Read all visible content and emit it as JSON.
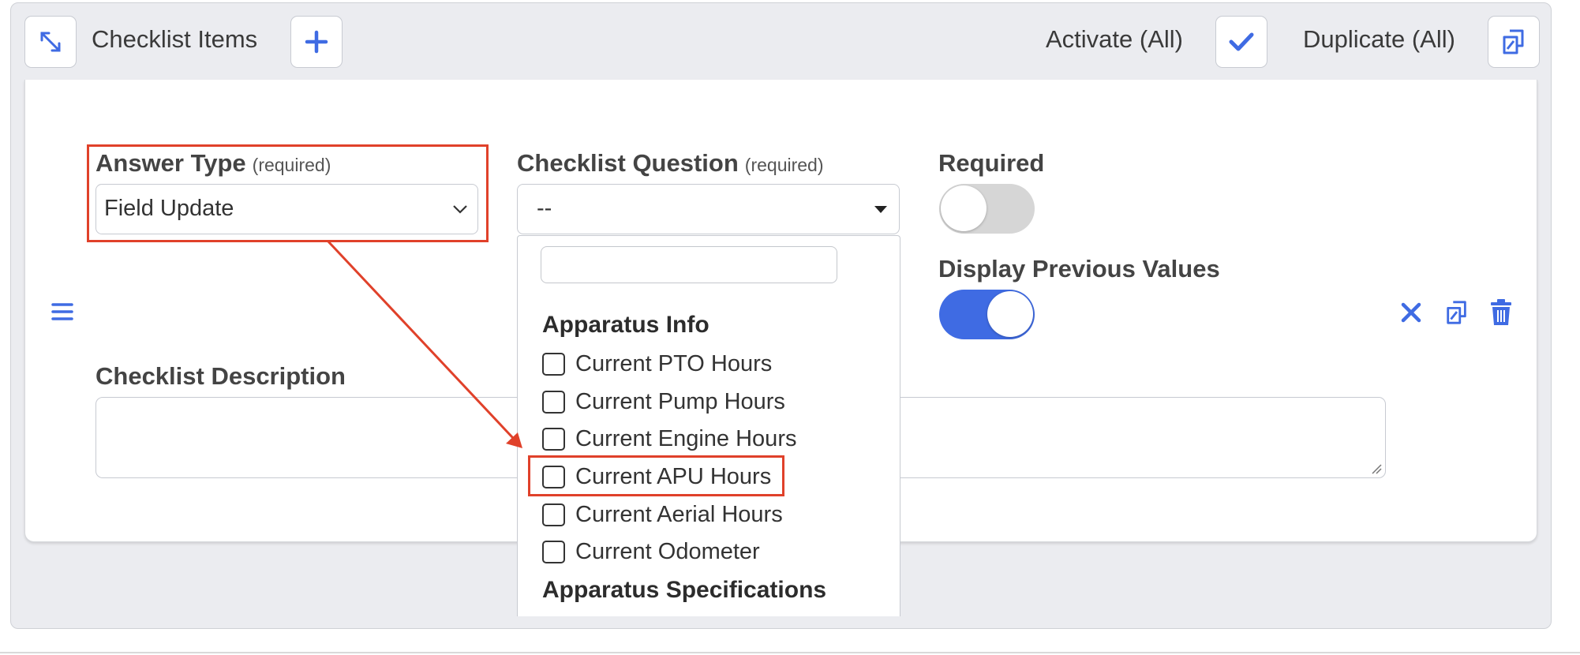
{
  "header": {
    "title": "Checklist Items",
    "activate_label": "Activate (All)",
    "duplicate_label": "Duplicate (All)"
  },
  "form": {
    "answer_type": {
      "label": "Answer Type",
      "required_note": "(required)",
      "value": "Field Update"
    },
    "checklist_question": {
      "label": "Checklist Question",
      "required_note": "(required)",
      "value": "--"
    },
    "required": {
      "label": "Required",
      "on": false
    },
    "display_previous_values": {
      "label": "Display Previous Values",
      "on": true
    },
    "description": {
      "label": "Checklist Description",
      "value": ""
    }
  },
  "dropdown": {
    "search_value": "",
    "groups": [
      {
        "label": "Apparatus Info",
        "options": [
          "Current PTO Hours",
          "Current Pump Hours",
          "Current Engine Hours",
          "Current APU Hours",
          "Current Aerial Hours",
          "Current Odometer"
        ]
      },
      {
        "label": "Apparatus Specifications",
        "options": []
      }
    ]
  },
  "colors": {
    "accent": "#3f6be3",
    "annotation": "#e0412a",
    "toggle_off": "#d6d6d6",
    "panel_bg": "#ebecf0"
  },
  "icons": {
    "expand": "expand-icon",
    "add": "plus-icon",
    "check": "check-icon",
    "duplicate": "duplicate-icon",
    "drag": "drag-handle-icon",
    "close": "close-icon",
    "delete": "trash-icon",
    "caret": "caret-down-icon"
  }
}
